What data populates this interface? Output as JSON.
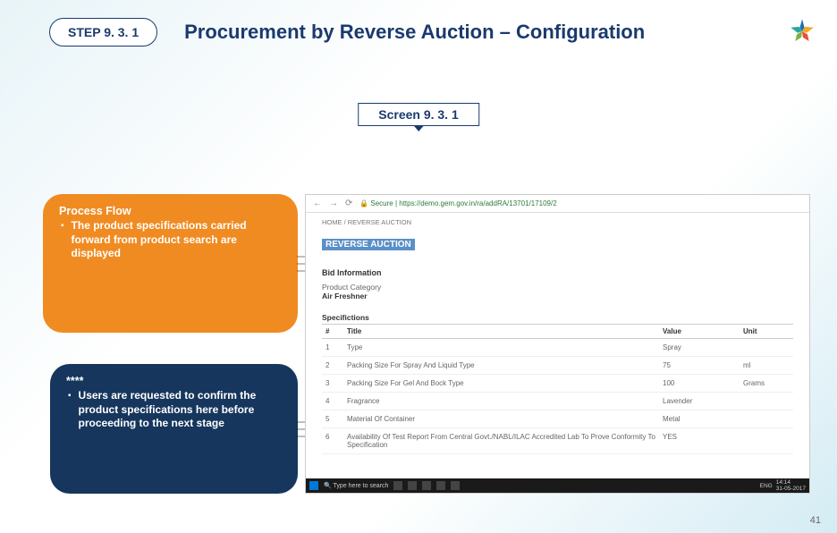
{
  "header": {
    "step": "STEP 9. 3. 1",
    "title": "Procurement by Reverse Auction – Configuration"
  },
  "screenLabel": "Screen 9. 3. 1",
  "processFlow": {
    "heading": "Process Flow",
    "item": "The product specifications carried forward from product search are displayed"
  },
  "note": {
    "stars": "****",
    "item": "Users are requested to confirm the product specifications here before proceeding to the next stage"
  },
  "screenshot": {
    "secure": "Secure",
    "url": "https://demo.gem.gov.in/ra/addRA/13701/17109/2",
    "breadcrumb": "HOME / REVERSE AUCTION",
    "raTitle": "REVERSE AUCTION",
    "bidInfo": "Bid Information",
    "pcLabel": "Product Category",
    "pcValue": "Air Freshner",
    "specHeader": "Specifictions",
    "cols": {
      "num": "#",
      "title": "Title",
      "value": "Value",
      "unit": "Unit"
    },
    "rows": [
      {
        "n": "1",
        "t": "Type",
        "v": "Spray",
        "u": ""
      },
      {
        "n": "2",
        "t": "Packing Size For Spray And Liquid Type",
        "v": "75",
        "u": "ml"
      },
      {
        "n": "3",
        "t": "Packing Size For Gel And Bock Type",
        "v": "100",
        "u": "Grams"
      },
      {
        "n": "4",
        "t": "Fragrance",
        "v": "Lavender",
        "u": ""
      },
      {
        "n": "5",
        "t": "Material Of Container",
        "v": "Metal",
        "u": ""
      },
      {
        "n": "6",
        "t": "Availability Of Test Report From Central Govt./NABL/ILAC Accredited Lab To Prove Conformity To Specification",
        "v": "YES",
        "u": ""
      }
    ],
    "searchPlaceholder": "Type here to search",
    "lang": "ENG",
    "time": "14:14",
    "date": "31-05-2017"
  },
  "pageNum": "41"
}
